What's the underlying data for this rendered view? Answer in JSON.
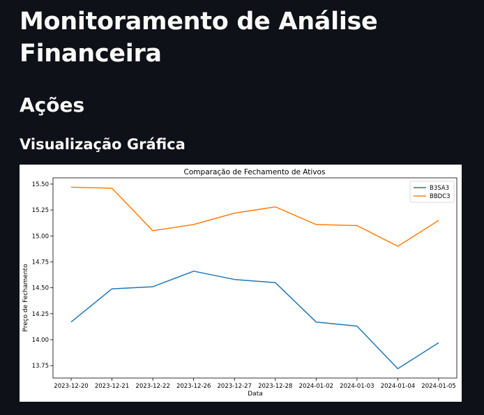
{
  "page": {
    "title": "Monitoramento de Análise Financeira",
    "section_header": "Ações",
    "subsection_header": "Visualização Gráfica"
  },
  "chart_data": {
    "type": "line",
    "title": "Comparação de Fechamento de Ativos",
    "xlabel": "Data",
    "ylabel": "Preço de Fechamento",
    "categories": [
      "2023-12-20",
      "2023-12-21",
      "2023-12-22",
      "2023-12-26",
      "2023-12-27",
      "2023-12-28",
      "2024-01-02",
      "2024-01-03",
      "2024-01-04",
      "2024-01-05"
    ],
    "yticks": [
      "13.75",
      "14.00",
      "14.25",
      "14.50",
      "14.75",
      "15.00",
      "15.25",
      "15.50"
    ],
    "ylim": [
      13.63,
      15.56
    ],
    "grid": false,
    "legend_position": "top-right",
    "series": [
      {
        "name": "B3SA3",
        "color": "#1f77b4",
        "values": [
          14.17,
          14.49,
          14.51,
          14.66,
          14.58,
          14.55,
          14.17,
          14.13,
          13.72,
          13.97
        ]
      },
      {
        "name": "BBDC3",
        "color": "#ff7f0e",
        "values": [
          15.47,
          15.46,
          15.05,
          15.11,
          15.22,
          15.28,
          15.11,
          15.1,
          14.9,
          15.15
        ]
      }
    ]
  }
}
